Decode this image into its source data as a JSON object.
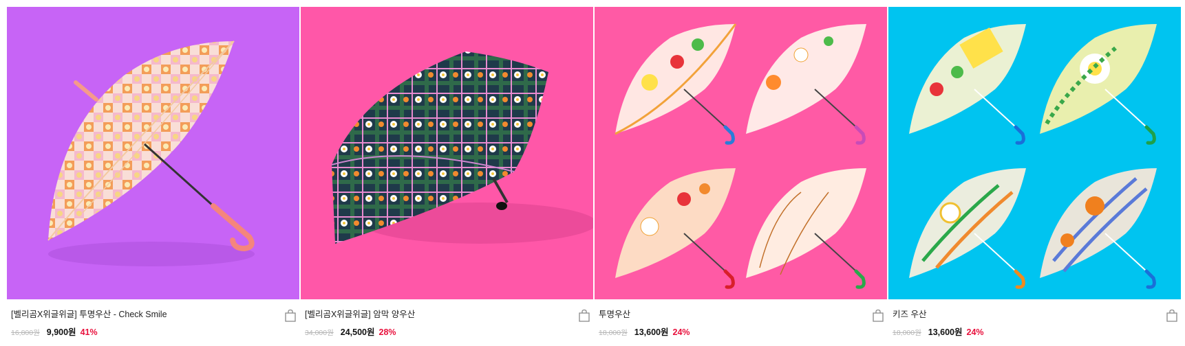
{
  "products": [
    {
      "name": "[벨리곰X위글위글] 투명우산 - Check Smile",
      "original_price": "16,800원",
      "price": "9,900원",
      "discount": "41%",
      "bg_color": "#c764f6",
      "image_icon": "umbrella-icon"
    },
    {
      "name": "[벨리곰X위글위글] 암막 양우산",
      "original_price": "34,000원",
      "price": "24,500원",
      "discount": "28%",
      "bg_color": "#ff57a8",
      "image_icon": "umbrella-icon"
    },
    {
      "name": "투명우산",
      "original_price": "18,000원",
      "price": "13,600원",
      "discount": "24%",
      "bg_color": "#ff5aa5",
      "image_icon": "umbrella-icon"
    },
    {
      "name": "키즈 우산",
      "original_price": "18,000원",
      "price": "13,600원",
      "discount": "24%",
      "bg_color": "#00c4f0",
      "image_icon": "umbrella-icon"
    }
  ],
  "colors": {
    "discount": "#e8103c",
    "strike": "#b5b5b5"
  },
  "icons": {
    "cart": "shopping-bag-icon"
  }
}
